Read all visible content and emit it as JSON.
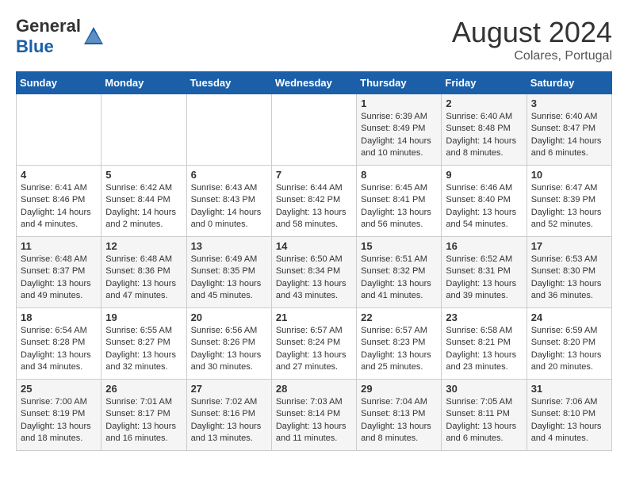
{
  "header": {
    "logo_general": "General",
    "logo_blue": "Blue",
    "month_year": "August 2024",
    "location": "Colares, Portugal"
  },
  "weekdays": [
    "Sunday",
    "Monday",
    "Tuesday",
    "Wednesday",
    "Thursday",
    "Friday",
    "Saturday"
  ],
  "weeks": [
    [
      {
        "day": "",
        "info": ""
      },
      {
        "day": "",
        "info": ""
      },
      {
        "day": "",
        "info": ""
      },
      {
        "day": "",
        "info": ""
      },
      {
        "day": "1",
        "info": "Sunrise: 6:39 AM\nSunset: 8:49 PM\nDaylight: 14 hours and 10 minutes."
      },
      {
        "day": "2",
        "info": "Sunrise: 6:40 AM\nSunset: 8:48 PM\nDaylight: 14 hours and 8 minutes."
      },
      {
        "day": "3",
        "info": "Sunrise: 6:40 AM\nSunset: 8:47 PM\nDaylight: 14 hours and 6 minutes."
      }
    ],
    [
      {
        "day": "4",
        "info": "Sunrise: 6:41 AM\nSunset: 8:46 PM\nDaylight: 14 hours and 4 minutes."
      },
      {
        "day": "5",
        "info": "Sunrise: 6:42 AM\nSunset: 8:44 PM\nDaylight: 14 hours and 2 minutes."
      },
      {
        "day": "6",
        "info": "Sunrise: 6:43 AM\nSunset: 8:43 PM\nDaylight: 14 hours and 0 minutes."
      },
      {
        "day": "7",
        "info": "Sunrise: 6:44 AM\nSunset: 8:42 PM\nDaylight: 13 hours and 58 minutes."
      },
      {
        "day": "8",
        "info": "Sunrise: 6:45 AM\nSunset: 8:41 PM\nDaylight: 13 hours and 56 minutes."
      },
      {
        "day": "9",
        "info": "Sunrise: 6:46 AM\nSunset: 8:40 PM\nDaylight: 13 hours and 54 minutes."
      },
      {
        "day": "10",
        "info": "Sunrise: 6:47 AM\nSunset: 8:39 PM\nDaylight: 13 hours and 52 minutes."
      }
    ],
    [
      {
        "day": "11",
        "info": "Sunrise: 6:48 AM\nSunset: 8:37 PM\nDaylight: 13 hours and 49 minutes."
      },
      {
        "day": "12",
        "info": "Sunrise: 6:48 AM\nSunset: 8:36 PM\nDaylight: 13 hours and 47 minutes."
      },
      {
        "day": "13",
        "info": "Sunrise: 6:49 AM\nSunset: 8:35 PM\nDaylight: 13 hours and 45 minutes."
      },
      {
        "day": "14",
        "info": "Sunrise: 6:50 AM\nSunset: 8:34 PM\nDaylight: 13 hours and 43 minutes."
      },
      {
        "day": "15",
        "info": "Sunrise: 6:51 AM\nSunset: 8:32 PM\nDaylight: 13 hours and 41 minutes."
      },
      {
        "day": "16",
        "info": "Sunrise: 6:52 AM\nSunset: 8:31 PM\nDaylight: 13 hours and 39 minutes."
      },
      {
        "day": "17",
        "info": "Sunrise: 6:53 AM\nSunset: 8:30 PM\nDaylight: 13 hours and 36 minutes."
      }
    ],
    [
      {
        "day": "18",
        "info": "Sunrise: 6:54 AM\nSunset: 8:28 PM\nDaylight: 13 hours and 34 minutes."
      },
      {
        "day": "19",
        "info": "Sunrise: 6:55 AM\nSunset: 8:27 PM\nDaylight: 13 hours and 32 minutes."
      },
      {
        "day": "20",
        "info": "Sunrise: 6:56 AM\nSunset: 8:26 PM\nDaylight: 13 hours and 30 minutes."
      },
      {
        "day": "21",
        "info": "Sunrise: 6:57 AM\nSunset: 8:24 PM\nDaylight: 13 hours and 27 minutes."
      },
      {
        "day": "22",
        "info": "Sunrise: 6:57 AM\nSunset: 8:23 PM\nDaylight: 13 hours and 25 minutes."
      },
      {
        "day": "23",
        "info": "Sunrise: 6:58 AM\nSunset: 8:21 PM\nDaylight: 13 hours and 23 minutes."
      },
      {
        "day": "24",
        "info": "Sunrise: 6:59 AM\nSunset: 8:20 PM\nDaylight: 13 hours and 20 minutes."
      }
    ],
    [
      {
        "day": "25",
        "info": "Sunrise: 7:00 AM\nSunset: 8:19 PM\nDaylight: 13 hours and 18 minutes."
      },
      {
        "day": "26",
        "info": "Sunrise: 7:01 AM\nSunset: 8:17 PM\nDaylight: 13 hours and 16 minutes."
      },
      {
        "day": "27",
        "info": "Sunrise: 7:02 AM\nSunset: 8:16 PM\nDaylight: 13 hours and 13 minutes."
      },
      {
        "day": "28",
        "info": "Sunrise: 7:03 AM\nSunset: 8:14 PM\nDaylight: 13 hours and 11 minutes."
      },
      {
        "day": "29",
        "info": "Sunrise: 7:04 AM\nSunset: 8:13 PM\nDaylight: 13 hours and 8 minutes."
      },
      {
        "day": "30",
        "info": "Sunrise: 7:05 AM\nSunset: 8:11 PM\nDaylight: 13 hours and 6 minutes."
      },
      {
        "day": "31",
        "info": "Sunrise: 7:06 AM\nSunset: 8:10 PM\nDaylight: 13 hours and 4 minutes."
      }
    ]
  ]
}
